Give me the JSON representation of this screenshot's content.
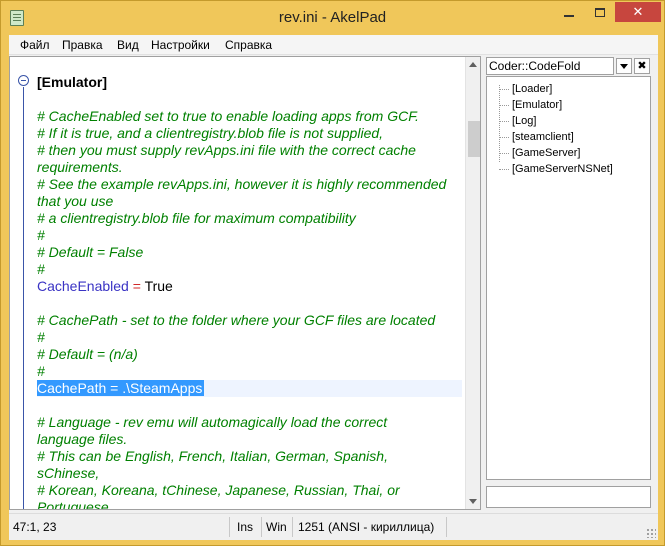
{
  "window": {
    "title": "rev.ini - AkelPad",
    "close_glyph": "✕"
  },
  "menu": [
    "Файл",
    "Правка",
    "Вид",
    "Настройки",
    "Справка"
  ],
  "editor": {
    "lines": [
      {
        "type": "section",
        "text": "[Emulator]"
      },
      {
        "type": "blank",
        "text": ""
      },
      {
        "type": "comment",
        "text": "# CacheEnabled set to true to enable loading apps from GCF."
      },
      {
        "type": "comment",
        "text": "# If it is true, and a clientregistry.blob file is not supplied,"
      },
      {
        "type": "comment",
        "text": "# then you must supply revApps.ini file with the correct cache"
      },
      {
        "type": "comment",
        "text": "requirements."
      },
      {
        "type": "comment",
        "text": "# See the example revApps.ini, however it is highly recommended"
      },
      {
        "type": "comment",
        "text": "that you use"
      },
      {
        "type": "comment",
        "text": "# a clientregistry.blob file for maximum compatibility"
      },
      {
        "type": "comment",
        "text": "#"
      },
      {
        "type": "comment",
        "text": "# Default = False"
      },
      {
        "type": "comment",
        "text": "#"
      },
      {
        "type": "kv",
        "key": "CacheEnabled",
        "eq": " = ",
        "value": "True"
      },
      {
        "type": "blank",
        "text": ""
      },
      {
        "type": "comment",
        "text": "# CachePath - set to the folder where your GCF files are located"
      },
      {
        "type": "comment",
        "text": "#"
      },
      {
        "type": "comment",
        "text": "# Default = (n/a)"
      },
      {
        "type": "comment",
        "text": "#"
      },
      {
        "type": "selected",
        "text": "CachePath = .\\SteamApps"
      },
      {
        "type": "blank",
        "text": ""
      },
      {
        "type": "comment",
        "text": "# Language - rev emu will automagically load the correct"
      },
      {
        "type": "comment",
        "text": "language files."
      },
      {
        "type": "comment",
        "text": "# This can be English, French, Italian, German, Spanish,"
      },
      {
        "type": "comment",
        "text": "sChinese,"
      },
      {
        "type": "comment",
        "text": "# Korean, Koreana, tChinese, Japanese, Russian, Thai, or"
      },
      {
        "type": "comment",
        "text": "Portuguese"
      }
    ]
  },
  "panel": {
    "title": "Coder::CodeFold",
    "close_glyph": "✖",
    "tree": [
      "[Loader]",
      "[Emulator]",
      "[Log]",
      "[steamclient]",
      "[GameServer]",
      "[GameServerNSNet]"
    ],
    "filter_value": ""
  },
  "status": {
    "position": "47:1, 23",
    "mode": "Ins",
    "newline": "Win",
    "codepage": "1251  (ANSI - кириллица)"
  }
}
